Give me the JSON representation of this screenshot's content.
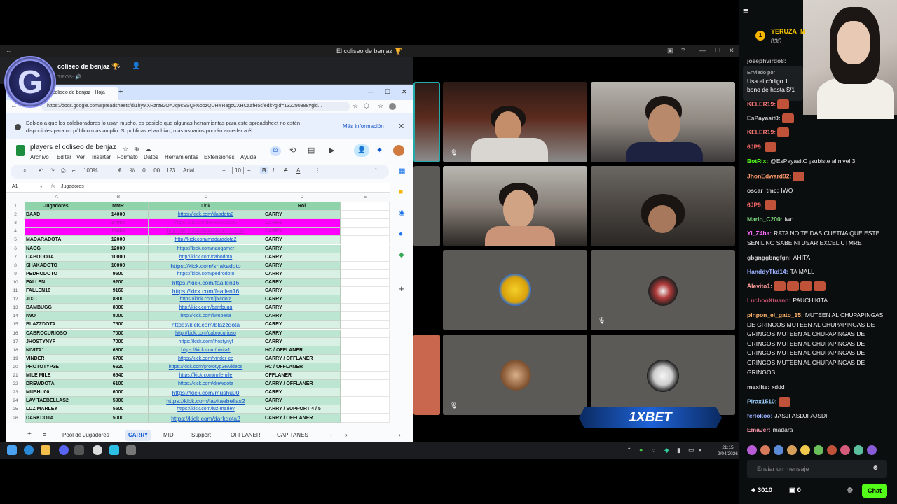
{
  "remote_window": {
    "title": "El coliseo de benjaz 🏆",
    "discord_server": "coliseo de benjaz 🏆",
    "discord_sub": "TIPOS- 🔊"
  },
  "browser": {
    "tab_title": "coliseo de benjaz - Hoja",
    "url": "https://docs.google.com/spreadsheets/d/1hy9jXRzrz82OAJq9cSSQR6oozQUHYRagcCXHCaafH5c/edit?gid=132290388#gid...",
    "info_message": "Debido a que los colaboradores lo usan mucho, es posible que algunas herramientas para este spreadsheet no estén disponibles para un público más amplio. Si publicas el archivo, más usuarios podrán acceder a él.",
    "info_more": "Más información"
  },
  "sheet": {
    "title": "players el coliseo de benjaz",
    "menus": [
      "Archivo",
      "Editar",
      "Ver",
      "Insertar",
      "Formato",
      "Datos",
      "Herramientas",
      "Extensiones",
      "Ayuda"
    ],
    "zoom": "100%",
    "font": "Arial",
    "font_size": "10",
    "cell_ref": "A1",
    "formula": "Jugadores",
    "badge": "92",
    "col_letters": [
      "A",
      "B",
      "C",
      "D",
      "E"
    ],
    "headers": [
      "Jugadores",
      "MMR",
      "Link",
      "Rol"
    ],
    "rows": [
      {
        "n": "2",
        "name": "DAAD",
        "mmr": "14000",
        "link": "https://kick.com/daadota2",
        "rol": "CARRY"
      },
      {
        "n": "3",
        "name": "",
        "mmr": "14000",
        "link": "https://kick.com/xxxxxxxxxxx",
        "rol": "CARRY"
      },
      {
        "n": "4",
        "name": "",
        "mmr": "13000",
        "link": "https://kick.com/xxxxxxxxxxxxxxxxx",
        "rol": "CARRY"
      },
      {
        "n": "5",
        "name": "MADARADOTA",
        "mmr": "12000",
        "link": "http://kick.com/madaradota2",
        "rol": "CARRY"
      },
      {
        "n": "6",
        "name": "NAOG",
        "mmr": "12000",
        "link": "https://kick.com/naogamer",
        "rol": "CARRY"
      },
      {
        "n": "7",
        "name": "CABODOTA",
        "mmr": "10000",
        "link": "http://kick.com/cabodota",
        "rol": "CARRY"
      },
      {
        "n": "8",
        "name": "SHAKADOTO",
        "mmr": "10000",
        "link": "https://kick.com/shakadoto",
        "rol": "CARRY"
      },
      {
        "n": "9",
        "name": "PEDRODOTO",
        "mmr": "9500",
        "link": "https://kick.com/pedrodoto",
        "rol": "CARRY"
      },
      {
        "n": "10",
        "name": "FALLEN",
        "mmr": "9200",
        "link": "https://kick.com/faallen16",
        "rol": "CARRY"
      },
      {
        "n": "11",
        "name": "FALLEN16",
        "mmr": "9160",
        "link": "https://kick.com/faallen16",
        "rol": "CARRY"
      },
      {
        "n": "12",
        "name": "JIXC",
        "mmr": "8800",
        "link": "https://kick.com/jixcdota",
        "rol": "CARRY"
      },
      {
        "n": "13",
        "name": "BAMBUGG",
        "mmr": "8000",
        "link": "http://kick.com/bambugg",
        "rol": "CARRY"
      },
      {
        "n": "14",
        "name": "IWO",
        "mmr": "8000",
        "link": "http://kick.com/iwobeka",
        "rol": "CARRY"
      },
      {
        "n": "15",
        "name": "BLAZZDOTA",
        "mmr": "7500",
        "link": "https://kick.com/blazzdota",
        "rol": "CARRY"
      },
      {
        "n": "16",
        "name": "CABROCURIOSO",
        "mmr": "7000",
        "link": "http://kick.com/cabrocurioso",
        "rol": "CARRY"
      },
      {
        "n": "17",
        "name": "JHOSTYNYF",
        "mmr": "7000",
        "link": "https://kick.com/jhostynyf",
        "rol": "CARRY"
      },
      {
        "n": "18",
        "name": "NIVITA1",
        "mmr": "6800",
        "link": "https://kick.com/nivita1",
        "rol": "HC / OFFLANER"
      },
      {
        "n": "19",
        "name": "VINDER",
        "mmr": "6700",
        "link": "https://kick.com/vinder-ce",
        "rol": "CARRY / OFFLANER"
      },
      {
        "n": "20",
        "name": "PROTOTYP3E",
        "mmr": "6620",
        "link": "https://kick.com/prototyp3e/videos",
        "rol": "HC / OFFLANER"
      },
      {
        "n": "21",
        "name": "MILE MILE",
        "mmr": "6540",
        "link": "https://kick.com/milemile",
        "rol": "OFFLANER"
      },
      {
        "n": "22",
        "name": "DREWDOTA",
        "mmr": "6100",
        "link": "https://kick.com/drewdota",
        "rol": "CARRY / OFFLANER"
      },
      {
        "n": "23",
        "name": "MUSHU00",
        "mmr": "6000",
        "link": "https://kick.com/mushu00",
        "rol": "CARRY"
      },
      {
        "n": "24",
        "name": "LAVITAEBELLAS2",
        "mmr": "5900",
        "link": "https://kick.com/lavitaebellas2",
        "rol": "CARRY"
      },
      {
        "n": "25",
        "name": "LUZ MARLEY",
        "mmr": "5500",
        "link": "https://kick.com/luz-marley",
        "rol": "CARRY / SUPPORT 4 / 5"
      },
      {
        "n": "26",
        "name": "DARKDOTA",
        "mmr": "5000",
        "link": "https://kick.com/darkdota2",
        "rol": "CARRY / OFFLANER"
      }
    ],
    "tabs": [
      "Pool de Jugadores",
      "CARRY",
      "MID",
      "Support",
      "OFFLANER",
      "CAPITANES"
    ]
  },
  "video": {
    "sponsor": "1XBET"
  },
  "taskbar": {
    "time": "21:15",
    "date": "9/04/2026"
  },
  "chat": {
    "top_user": "YERUZA_M",
    "top_points": "835",
    "top_rank": "1",
    "pinned_by": "Enviado por",
    "pinned_text": "Usa el código 1 bono de hasta $/1",
    "messages": [
      {
        "user": "josephvirdo8:",
        "text": "",
        "color": "#b0b0b0",
        "emotes": 0
      },
      {
        "user": "KELER19:",
        "text": "",
        "color": "#ff7b7b",
        "emotes": 1
      },
      {
        "user": "EsPayasit0:",
        "text": "",
        "color": "#d0d0d0",
        "emotes": 1
      },
      {
        "user": "KELER19:",
        "text": "",
        "color": "#ff7b7b",
        "emotes": 1
      },
      {
        "user": "6JP9:",
        "text": "",
        "color": "#ff6b6b",
        "emotes": 1
      },
      {
        "user": "BotRix:",
        "text": "@EsPayasitO ¡subiste al nivel 3!",
        "color": "#53fc18",
        "emotes": 0
      },
      {
        "user": "JhonEdward92:",
        "text": "",
        "color": "#ff9b6b",
        "emotes": 1
      },
      {
        "user": "oscar_tmc:",
        "text": "IWO",
        "color": "#d0d0d0",
        "emotes": 0
      },
      {
        "user": "6JP9:",
        "text": "",
        "color": "#ff6b6b",
        "emotes": 1
      },
      {
        "user": "Mario_C200:",
        "text": "iwo",
        "color": "#7bd47b",
        "emotes": 0
      },
      {
        "user": "Yi_Z4ha:",
        "text": "RATA NO TE DAS CUETNA QUE ESTE SENIL NO SABE NI USAR EXCEL CTMRE",
        "color": "#ff6bff",
        "emotes": 0
      },
      {
        "user": "gbgnggbngfgn:",
        "text": "AHITA",
        "color": "#d0d0d0",
        "emotes": 0
      },
      {
        "user": "HanddyTkd14:",
        "text": "TA MALL",
        "color": "#9bb0ff",
        "emotes": 0
      },
      {
        "user": "Alevito1:",
        "text": "",
        "color": "#ff9b9b",
        "emotes": 4
      },
      {
        "user": "LuchooXtuano:",
        "text": "PAUCHIKITA",
        "color": "#c0506b",
        "emotes": 0
      },
      {
        "user": "pinpon_el_gato_15:",
        "text": "MUTEEN AL CHUPAPINGAS DE GRINGOS MUTEEN AL CHUPAPINGAS DE GRINGOS MUTEEN AL CHUPAPINGAS DE GRINGOS MUTEEN AL CHUPAPINGAS DE GRINGOS MUTEEN AL CHUPAPINGAS DE GRINGOS MUTEEN AL CHUPAPINGAS DE GRINGOS",
        "color": "#ffb46b",
        "emotes": 0
      },
      {
        "user": "mexlite:",
        "text": "xddd",
        "color": "#d0d0d0",
        "emotes": 0
      },
      {
        "user": "Pirax1510:",
        "text": "",
        "color": "#9bd0ff",
        "emotes": 1
      },
      {
        "user": "ferlokoo:",
        "text": "JASJFASDJFAJSDF",
        "color": "#9bb0ff",
        "emotes": 0
      },
      {
        "user": "EmaJer:",
        "text": "madara",
        "color": "#ff9bb0",
        "emotes": 0
      }
    ],
    "input_placeholder": "Enviar un mensaje",
    "points": "3010",
    "zero": "0",
    "chat_button": "Chat"
  }
}
